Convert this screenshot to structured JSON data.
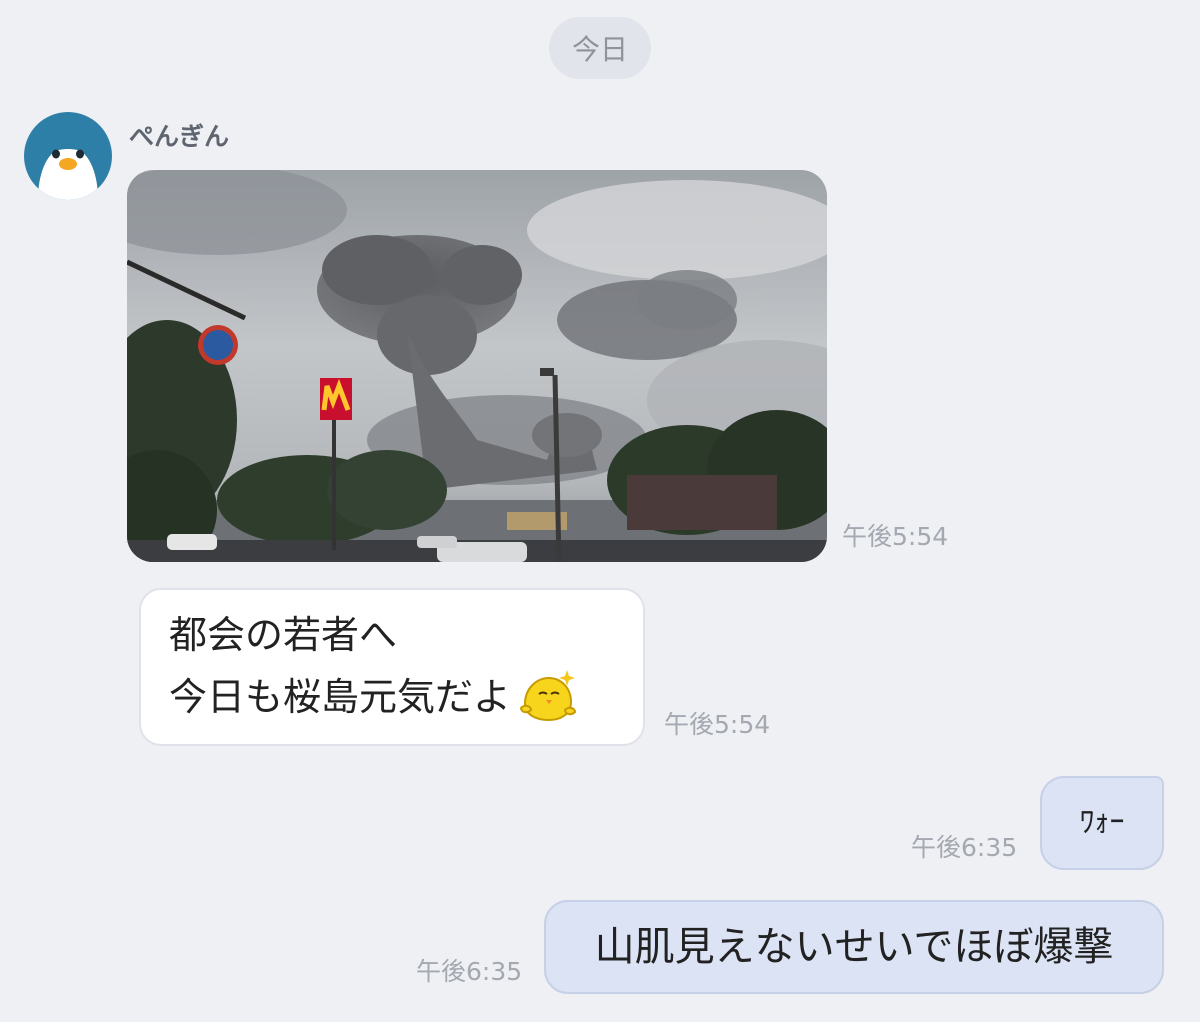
{
  "date_divider": "今日",
  "sender": {
    "name": "ぺんぎん",
    "avatar_icon": "penguin-avatar-icon"
  },
  "messages": [
    {
      "type": "image",
      "time": "午後5:54",
      "icon": "volcano-eruption-photo"
    },
    {
      "type": "text",
      "direction": "incoming",
      "lines": [
        "都会の若者へ",
        "今日も桜島元気だよ"
      ],
      "sticker_icon": "sparkle-chick-emoji",
      "time": "午後5:54"
    },
    {
      "type": "text",
      "direction": "outgoing",
      "text": "ﾜｫｰ",
      "time": "午後6:35"
    },
    {
      "type": "text",
      "direction": "outgoing",
      "text": "山肌見えないせいでほぼ爆撃",
      "time": "午後6:35"
    }
  ],
  "colors": {
    "background": "#eef0f4",
    "incoming_bubble": "#ffffff",
    "outgoing_bubble": "#dbe3f5",
    "avatar_bg": "#2e7fa8",
    "beak": "#f5a623"
  }
}
